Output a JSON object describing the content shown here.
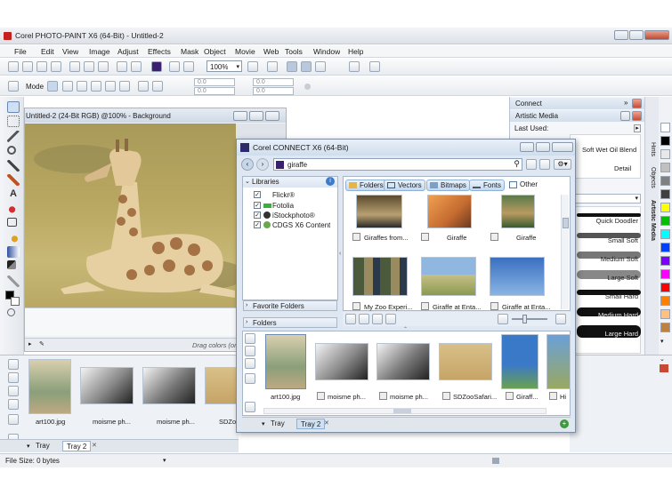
{
  "app": {
    "title": "Corel PHOTO-PAINT X6 (64-Bit) - Untitled-2",
    "menu": [
      "File",
      "Edit",
      "View",
      "Image",
      "Adjust",
      "Effects",
      "Mask",
      "Object",
      "Movie",
      "Web",
      "Tools",
      "Window",
      "Help"
    ],
    "zoom": "100%",
    "mode_label": "Mode",
    "coord_values": [
      "0.0",
      "0.0",
      "0.0",
      "0.0"
    ],
    "status_text": "File Size: 0 bytes"
  },
  "document": {
    "title": "Untitled-2 (24-Bit RGB) @100% - Background",
    "drag_hint": "Drag colors (or"
  },
  "tray": {
    "tabs": [
      "Tray",
      "Tray 2"
    ],
    "items": [
      "art100.jpg",
      "moisme ph...",
      "moisme ph...",
      "SDZoo"
    ]
  },
  "connect_panel": {
    "title": "Connect",
    "artistic_media": "Artistic Media",
    "last_used": "Last Used:",
    "last_used_items": [
      "Soft Wet Oil Blend",
      "Detail"
    ],
    "brushes": [
      "Quick Doodler",
      "Small Soft",
      "Medium Soft",
      "Large Soft",
      "Small Hard",
      "Medium Hard",
      "Large Hard"
    ],
    "side_tabs": [
      "Hints",
      "Objects",
      "Artistic Media"
    ]
  },
  "connect_window": {
    "title": "Corel CONNECT X6 (64-Bit)",
    "search_value": "giraffe",
    "libraries_label": "Libraries",
    "libraries": [
      "Flickr®",
      "Fotolia",
      "iStockphoto®",
      "CDGS X6 Content"
    ],
    "favorite_folders": "Favorite Folders",
    "folders_label": "Folders",
    "filters": [
      "Folders",
      "Vectors",
      "Bitmaps",
      "Fonts",
      "Other"
    ],
    "results_row1": [
      "Giraffes from...",
      "Giraffe",
      "Giraffe"
    ],
    "results_row2": [
      "My Zoo Experi...",
      "Giraffe at Enta...",
      "Giraffe at Enta..."
    ],
    "tray_items": [
      "art100.jpg",
      "moisme ph...",
      "moisme ph...",
      "SDZooSafari...",
      "Giraff...",
      "Hi"
    ],
    "tray_tabs": [
      "Tray",
      "Tray 2"
    ]
  },
  "colors": {
    "palette": [
      "#ffffff",
      "#000000",
      "#e8e8e8",
      "#c0c0c0",
      "#808080",
      "#404040",
      "#ffff00",
      "#00c000",
      "#00ffff",
      "#0040ff",
      "#8000ff",
      "#ff00ff",
      "#ff0000",
      "#ff8000",
      "#ffc080",
      "#c08040"
    ]
  }
}
